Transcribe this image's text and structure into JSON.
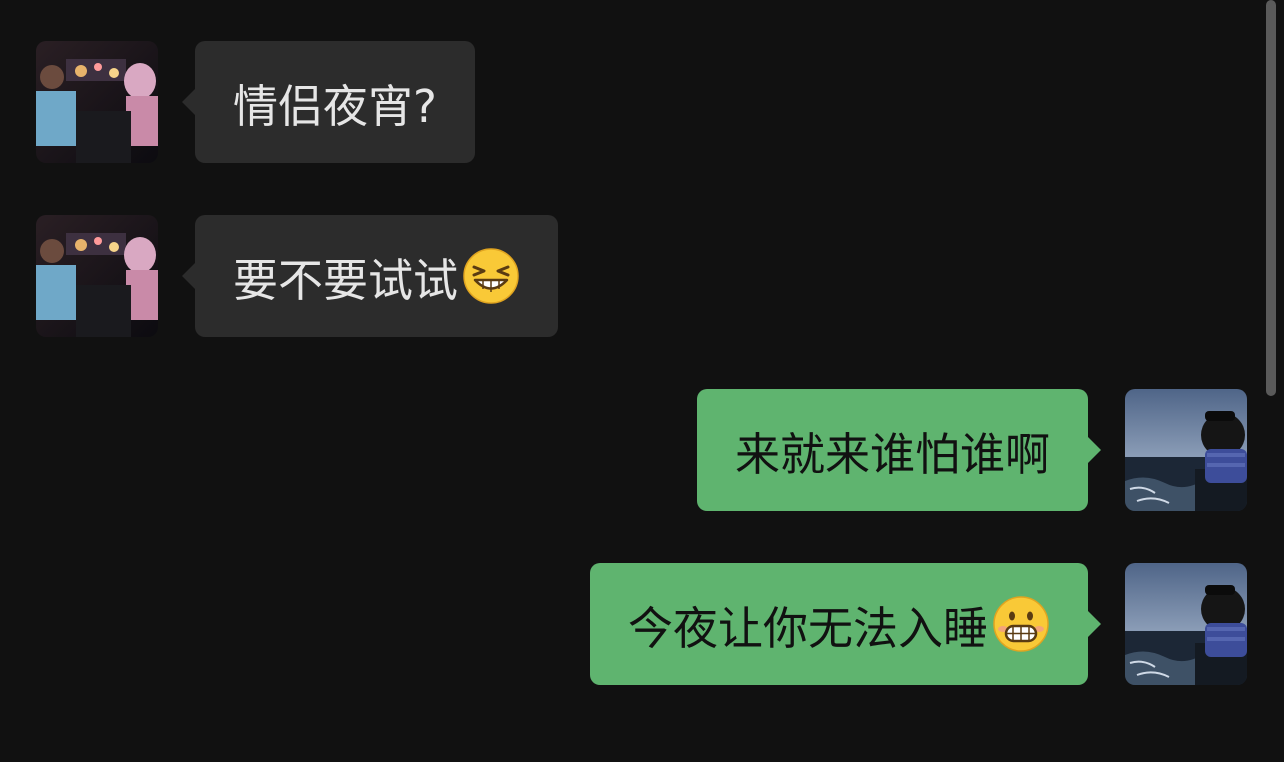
{
  "messages": [
    {
      "side": "incoming",
      "text": "情侣夜宵?"
    },
    {
      "side": "incoming",
      "text": "要不要试试",
      "emoji": "grinning-squinting-face"
    },
    {
      "side": "outgoing",
      "text": "来就来谁怕谁啊"
    },
    {
      "side": "outgoing",
      "text": "今夜让你无法入睡",
      "emoji": "grimacing-face"
    }
  ],
  "colors": {
    "background": "#111111",
    "incoming_bubble": "#2c2c2c",
    "outgoing_bubble": "#5fb46f"
  }
}
